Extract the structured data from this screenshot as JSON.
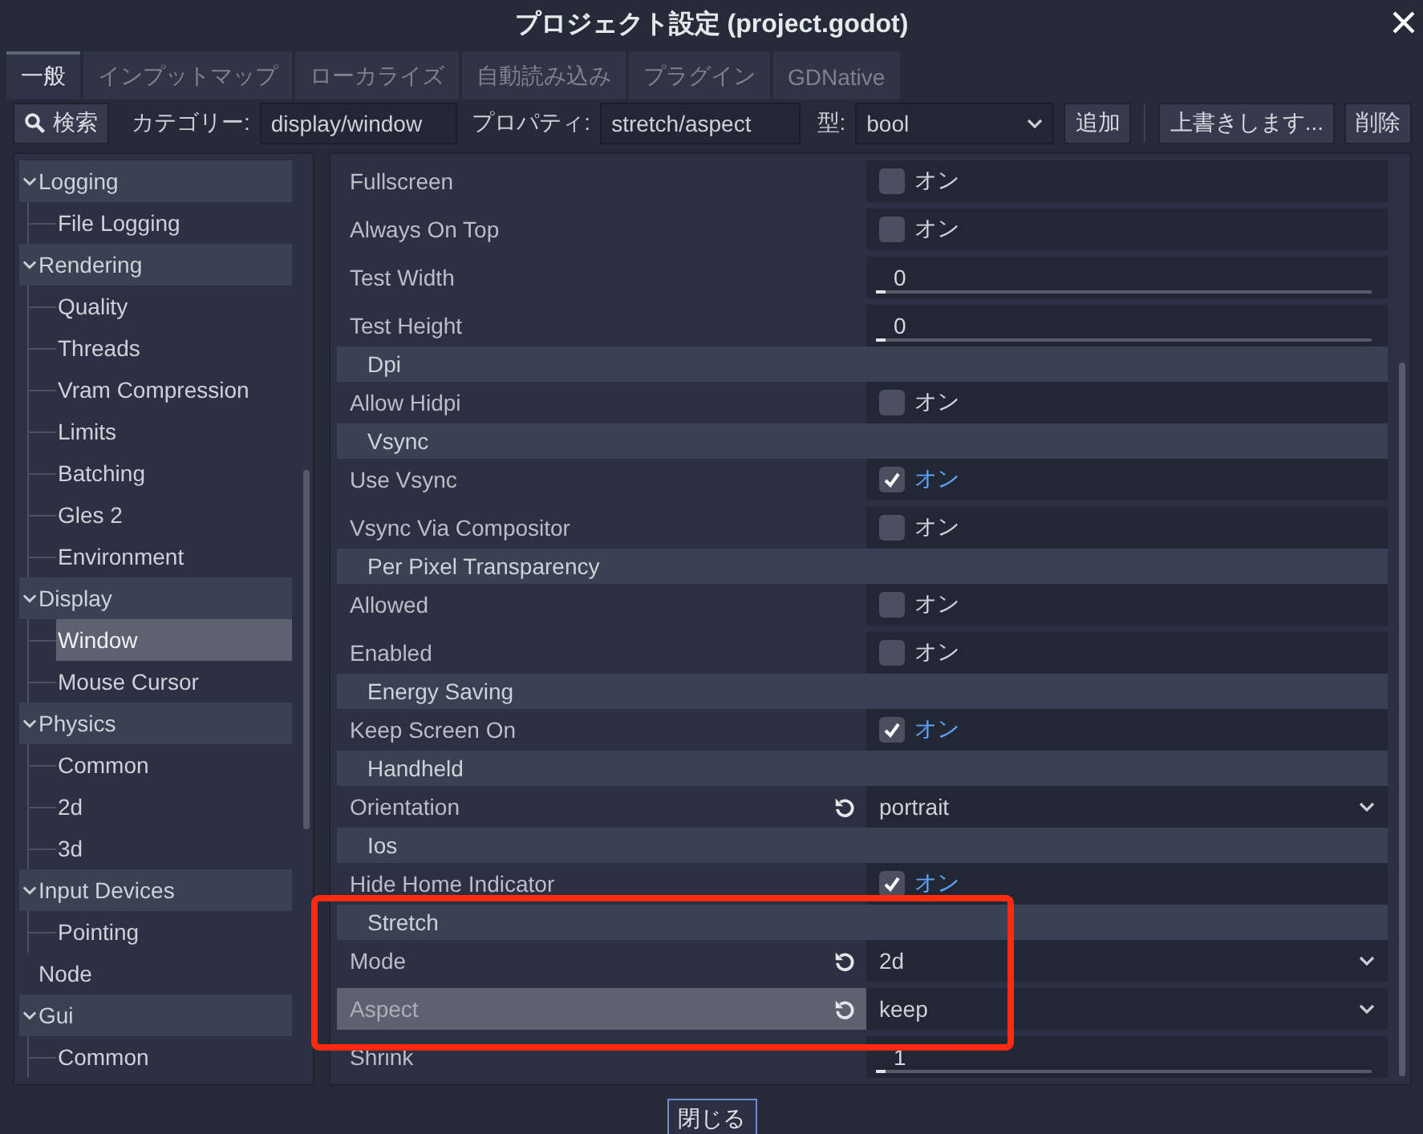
{
  "window": {
    "title": "プロジェクト設定 (project.godot)"
  },
  "tabs": [
    {
      "label": "一般",
      "selected": true
    },
    {
      "label": "インプットマップ",
      "selected": false
    },
    {
      "label": "ローカライズ",
      "selected": false
    },
    {
      "label": "自動読み込み",
      "selected": false
    },
    {
      "label": "プラグイン",
      "selected": false
    },
    {
      "label": "GDNative",
      "selected": false
    }
  ],
  "toolbar": {
    "search_button": "検索",
    "category_label": "カテゴリー:",
    "category_value": "display/window",
    "property_label": "プロパティ:",
    "property_value": "stretch/aspect",
    "type_label": "型:",
    "type_value": "bool",
    "add_button": "追加",
    "override_button": "上書きします...",
    "delete_button": "削除"
  },
  "tree": [
    {
      "label": "Logging",
      "selected": false,
      "children": [
        {
          "label": "File Logging",
          "selected": false
        }
      ]
    },
    {
      "label": "Rendering",
      "selected": false,
      "children": [
        {
          "label": "Quality",
          "selected": false
        },
        {
          "label": "Threads",
          "selected": false
        },
        {
          "label": "Vram Compression",
          "selected": false
        },
        {
          "label": "Limits",
          "selected": false
        },
        {
          "label": "Batching",
          "selected": false
        },
        {
          "label": "Gles 2",
          "selected": false
        },
        {
          "label": "Environment",
          "selected": false
        }
      ]
    },
    {
      "label": "Display",
      "selected": false,
      "children": [
        {
          "label": "Window",
          "selected": true
        },
        {
          "label": "Mouse Cursor",
          "selected": false
        }
      ]
    },
    {
      "label": "Physics",
      "selected": false,
      "children": [
        {
          "label": "Common",
          "selected": false
        },
        {
          "label": "2d",
          "selected": false
        },
        {
          "label": "3d",
          "selected": false
        }
      ]
    },
    {
      "label": "Input Devices",
      "selected": false,
      "children": [
        {
          "label": "Pointing",
          "selected": false
        }
      ]
    },
    {
      "label": "Node",
      "selected": false
    },
    {
      "label": "Gui",
      "selected": false,
      "children": [
        {
          "label": "Common",
          "selected": false
        }
      ]
    }
  ],
  "properties": [
    {
      "kind": "check",
      "label": "Fullscreen",
      "value": "オン",
      "checked": false,
      "selected": false,
      "changed": false
    },
    {
      "kind": "check",
      "label": "Always On Top",
      "value": "オン",
      "checked": false,
      "selected": false,
      "changed": false
    },
    {
      "kind": "number",
      "label": "Test Width",
      "value": "0",
      "level": 0,
      "selected": false,
      "changed": false
    },
    {
      "kind": "number",
      "label": "Test Height",
      "value": "0",
      "level": 0,
      "selected": false,
      "changed": false
    },
    {
      "kind": "section",
      "label": "Dpi"
    },
    {
      "kind": "check",
      "label": "Allow Hidpi",
      "value": "オン",
      "checked": false,
      "selected": false,
      "changed": false
    },
    {
      "kind": "section",
      "label": "Vsync"
    },
    {
      "kind": "check",
      "label": "Use Vsync",
      "value": "オン",
      "checked": true,
      "selected": false,
      "changed": false
    },
    {
      "kind": "check",
      "label": "Vsync Via Compositor",
      "value": "オン",
      "checked": false,
      "selected": false,
      "changed": false
    },
    {
      "kind": "section",
      "label": "Per Pixel Transparency"
    },
    {
      "kind": "check",
      "label": "Allowed",
      "value": "オン",
      "checked": false,
      "selected": false,
      "changed": false
    },
    {
      "kind": "check",
      "label": "Enabled",
      "value": "オン",
      "checked": false,
      "selected": false,
      "changed": false
    },
    {
      "kind": "section",
      "label": "Energy Saving"
    },
    {
      "kind": "check",
      "label": "Keep Screen On",
      "value": "オン",
      "checked": true,
      "selected": false,
      "changed": false
    },
    {
      "kind": "section",
      "label": "Handheld"
    },
    {
      "kind": "enum",
      "label": "Orientation",
      "value": "portrait",
      "selected": false,
      "changed": true
    },
    {
      "kind": "section",
      "label": "Ios"
    },
    {
      "kind": "check",
      "label": "Hide Home Indicator",
      "value": "オン",
      "checked": true,
      "selected": false,
      "changed": false
    },
    {
      "kind": "section",
      "label": "Stretch"
    },
    {
      "kind": "enum",
      "label": "Mode",
      "value": "2d",
      "selected": false,
      "changed": true
    },
    {
      "kind": "enum",
      "label": "Aspect",
      "value": "keep",
      "selected": true,
      "changed": true
    },
    {
      "kind": "number",
      "label": "Shrink",
      "value": "1",
      "level": 0,
      "selected": false,
      "changed": false
    }
  ],
  "close_button": "閉じる"
}
